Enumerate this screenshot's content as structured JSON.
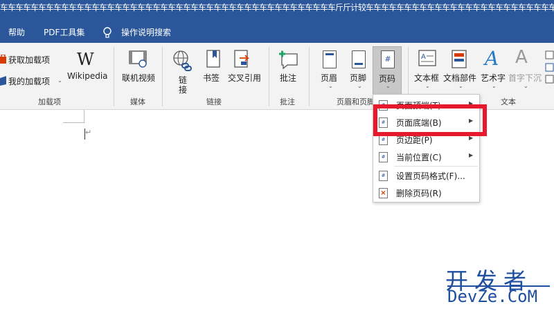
{
  "window": {
    "title": "车车车车车车车车车车车车车车车车车车车车车车车车车车车车车车车车车车车车车车车车车车车车斤斤计较车车车车车车车车车车车车车车车车车车车车车车车车车"
  },
  "menu": {
    "help": "帮助",
    "pdf_tools": "PDF工具集",
    "search": "操作说明搜索"
  },
  "ribbon": {
    "addins": {
      "get": "获取加载项",
      "my": "我的加载项",
      "wikipedia": "Wikipedia",
      "group": "加载项"
    },
    "media": {
      "online_video": "联机视频",
      "group": "媒体"
    },
    "links": {
      "link_1": "链",
      "link_2": "接",
      "bookmark": "书签",
      "cross_ref": "交叉引用",
      "group": "链接"
    },
    "comments": {
      "comment": "批注",
      "group": "批注"
    },
    "header_footer": {
      "header": "页眉",
      "footer": "页脚",
      "page_number": "页码",
      "group": "页眉和页脚"
    },
    "text": {
      "textbox": "文本框",
      "quickparts": "文档部件",
      "wordart": "艺术字",
      "dropcap": "首字下沉",
      "group": "文本"
    }
  },
  "dropdown": {
    "items": [
      {
        "label": "页面顶端(T)"
      },
      {
        "label": "页面底端(B)"
      },
      {
        "label": "页边距(P)"
      },
      {
        "label": "当前位置(C)"
      },
      {
        "label": "设置页码格式(F)..."
      },
      {
        "label": "删除页码(R)"
      }
    ]
  },
  "watermark": {
    "cn": "开发者",
    "en": "DevZe.CoM"
  },
  "colors": {
    "accent": "#2b579a",
    "highlight": "#e8192c"
  }
}
